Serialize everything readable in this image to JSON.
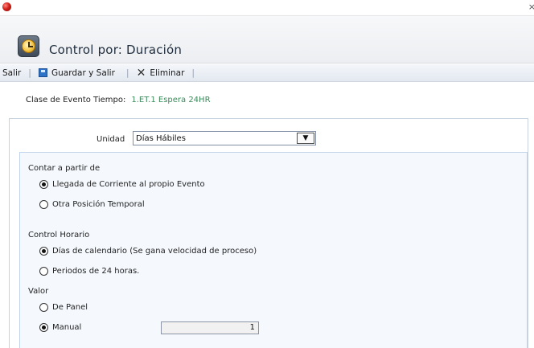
{
  "window": {
    "close_glyph": "×"
  },
  "header": {
    "title": "Control por: Duración",
    "icon": "clock-icon"
  },
  "toolbar": {
    "exit_label": "Salir",
    "save_exit_label": "Guardar y Salir",
    "delete_label": "Eliminar",
    "separator": "|"
  },
  "event": {
    "label": "Clase de Evento Tiempo:",
    "value": "1.ET.1 Espera 24HR"
  },
  "unidad": {
    "label": "Unidad",
    "selected": "Días Hábiles",
    "dropdown_glyph": "▼"
  },
  "contar": {
    "label": "Contar a partir de",
    "options": [
      "Llegada de Corriente al propio Evento",
      "Otra Posición Temporal"
    ],
    "selected_index": 0
  },
  "control_horario": {
    "label": "Control Horario",
    "options": [
      "Días de calendario (Se gana velocidad de proceso)",
      "Periodos de 24 horas."
    ],
    "selected_index": 0
  },
  "valor": {
    "label": "Valor",
    "options": [
      "De Panel",
      "Manual"
    ],
    "selected_index": 1,
    "manual_value": "1"
  }
}
